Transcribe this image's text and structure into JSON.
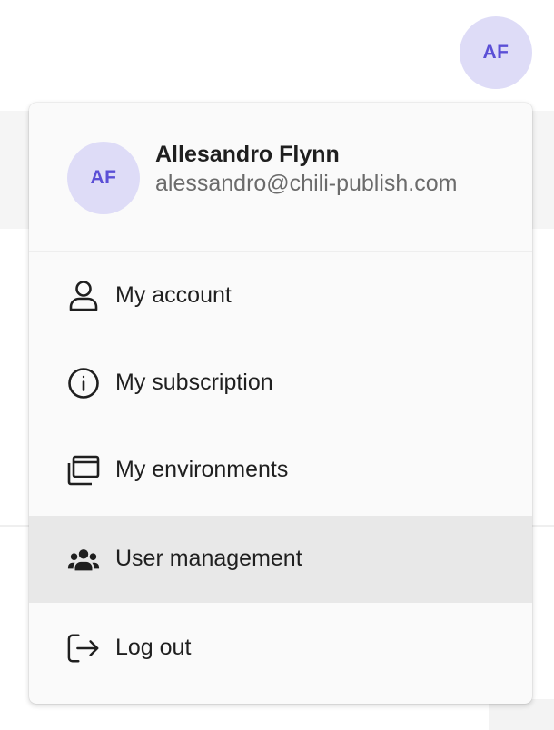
{
  "header": {
    "avatar_initials": "AF"
  },
  "user_menu": {
    "profile": {
      "initials": "AF",
      "name": "Allesandro Flynn",
      "email": "alessandro@chili-publish.com"
    },
    "items": [
      {
        "label": "My account",
        "icon": "user-icon"
      },
      {
        "label": "My subscription",
        "icon": "info-icon"
      },
      {
        "label": "My environments",
        "icon": "environments-icon"
      },
      {
        "label": "User management",
        "icon": "users-icon",
        "highlighted": true
      },
      {
        "label": "Log out",
        "icon": "logout-icon"
      }
    ]
  },
  "colors": {
    "avatar_bg": "#dedcf7",
    "avatar_text": "#5b4fd6",
    "menu_bg": "#fafafa",
    "highlight_bg": "#e8e8e8"
  }
}
